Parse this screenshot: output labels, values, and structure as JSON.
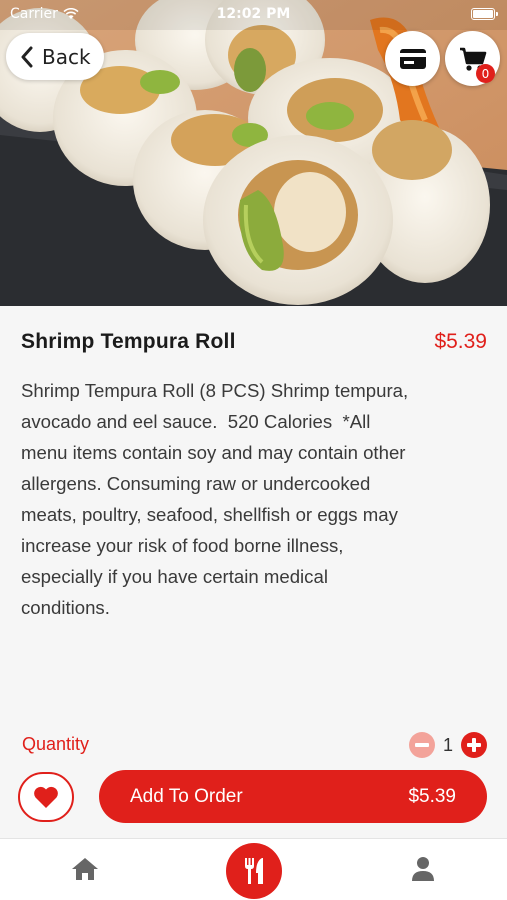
{
  "status_bar": {
    "carrier": "Carrier",
    "time": "12:02 PM"
  },
  "nav": {
    "back_label": "Back",
    "cart_count": "0"
  },
  "item": {
    "name": "Shrimp Tempura Roll",
    "price": "$5.39",
    "description": "Shrimp Tempura Roll (8 PCS) Shrimp tempura,\navocado and eel sauce.  520 Calories  *All\nmenu items contain soy and may contain other\nallergens. Consuming raw or undercooked\nmeats, poultry, seafood, shellfish or eggs may\nincrease your risk of food borne illness,\nespecially if you have certain medical\nconditions."
  },
  "quantity": {
    "label": "Quantity",
    "value": "1"
  },
  "actions": {
    "add_label": "Add To Order",
    "add_price": "$5.39"
  },
  "icons": {
    "back": "chevron-left-icon",
    "card": "credit-card-icon",
    "cart": "shopping-cart-icon",
    "minus": "minus-circle-icon",
    "plus": "plus-circle-icon",
    "favorite": "heart-icon",
    "home": "home-icon",
    "menu": "fork-knife-icon",
    "profile": "user-icon"
  },
  "colors": {
    "accent": "#e0201b",
    "accent_light": "#f3a39a",
    "background": "#f6f6f6"
  }
}
